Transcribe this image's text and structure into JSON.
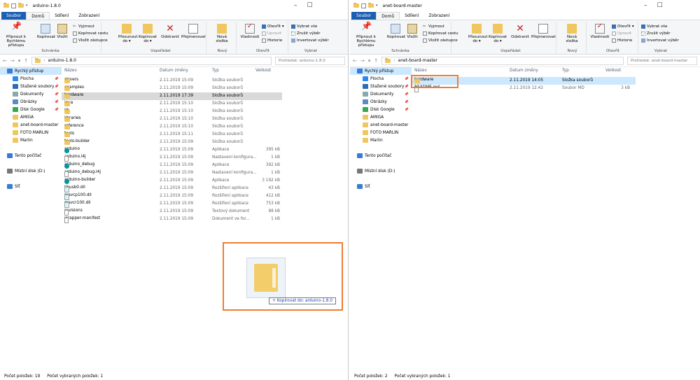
{
  "colors": {
    "accent": "#1a5fb4",
    "folder": "#f0c75e",
    "selected": "#cce8ff",
    "highlight": "#d9d9d9",
    "callout": "#ef7d33"
  },
  "left": {
    "title": "arduino-1.8.0",
    "tabs": [
      "Soubor",
      "Domů",
      "Sdílení",
      "Zobrazení"
    ],
    "ribbon": {
      "pin": "Připnout k Rychlému přístupu",
      "copy": "Kopírovat",
      "paste": "Vložit",
      "cut": "Vyjmout",
      "copy_path": "Kopírovat cestu",
      "paste_shortcut": "Vložit zástupce",
      "clipboard": "Schránka",
      "move_to": "Přesunout do ▾",
      "copy_to": "Kopírovat do ▾",
      "delete": "Odstranit",
      "rename": "Přejmenovat",
      "organize": "Uspořádat",
      "new_folder": "Nová složka",
      "new": "Nový",
      "properties": "Vlastnosti",
      "open": "Otevřít ▾",
      "edit": "Upravit",
      "history": "Historie",
      "open_group": "Otevřít",
      "select_all": "Vybrat vše",
      "select_none": "Zrušit výběr",
      "invert": "Invertovat výběr",
      "select_group": "Vybrat"
    },
    "path": "arduino-1.8.0",
    "search_placeholder": "Prohledat: arduino-1.8.0",
    "nav": [
      {
        "label": "Rychlý přístup",
        "icon": "star-icon",
        "pin": false
      },
      {
        "label": "Plocha",
        "icon": "desktop-icon",
        "pin": true
      },
      {
        "label": "Stažené soubory",
        "icon": "download-icon",
        "pin": true
      },
      {
        "label": "Dokumenty",
        "icon": "documents-icon",
        "pin": true
      },
      {
        "label": "Obrázky",
        "icon": "pictures-icon",
        "pin": true
      },
      {
        "label": "Disk Google",
        "icon": "google-drive-icon",
        "pin": true
      },
      {
        "label": "AMIGA",
        "icon": "folder-icon",
        "pin": false
      },
      {
        "label": "anet-board-master",
        "icon": "folder-icon",
        "pin": false
      },
      {
        "label": "FOTO MARLIN",
        "icon": "folder-icon",
        "pin": false
      },
      {
        "label": "Marlin",
        "icon": "folder-icon",
        "pin": false
      },
      {
        "label": "",
        "icon": "",
        "pin": false
      },
      {
        "label": "Tento počítač",
        "icon": "computer-icon",
        "pin": false
      },
      {
        "label": "",
        "icon": "",
        "pin": false
      },
      {
        "label": "Místní disk (D:)",
        "icon": "drive-icon",
        "pin": false
      },
      {
        "label": "",
        "icon": "",
        "pin": false
      },
      {
        "label": "Síť",
        "icon": "network-icon",
        "pin": false
      }
    ],
    "columns": [
      "Název",
      "Datum změny",
      "Typ",
      "Velikost"
    ],
    "files": [
      {
        "name": "drivers",
        "date": "2.11.2019 15:09",
        "type": "Složka souborů",
        "size": "",
        "icon": "folder"
      },
      {
        "name": "examples",
        "date": "2.11.2019 15:09",
        "type": "Složka souborů",
        "size": "",
        "icon": "folder"
      },
      {
        "name": "hardware",
        "date": "2.11.2019 17:39",
        "type": "Složka souborů",
        "size": "",
        "icon": "folder"
      },
      {
        "name": "java",
        "date": "2.11.2019 15:10",
        "type": "Složka souborů",
        "size": "",
        "icon": "folder"
      },
      {
        "name": "lib",
        "date": "2.11.2019 15:10",
        "type": "Složka souborů",
        "size": "",
        "icon": "folder"
      },
      {
        "name": "libraries",
        "date": "2.11.2019 15:10",
        "type": "Složka souborů",
        "size": "",
        "icon": "folder"
      },
      {
        "name": "reference",
        "date": "2.11.2019 15:10",
        "type": "Složka souborů",
        "size": "",
        "icon": "folder"
      },
      {
        "name": "tools",
        "date": "2.11.2019 15:11",
        "type": "Složka souborů",
        "size": "",
        "icon": "folder"
      },
      {
        "name": "tools-builder",
        "date": "2.11.2019 15:09",
        "type": "Složka souborů",
        "size": "",
        "icon": "folder"
      },
      {
        "name": "arduino",
        "date": "2.11.2019 15:09",
        "type": "Aplikace",
        "size": "395 kB",
        "icon": "app"
      },
      {
        "name": "arduino.l4j",
        "date": "2.11.2019 15:09",
        "type": "Nastavení konfigura...",
        "size": "1 kB",
        "icon": "file"
      },
      {
        "name": "arduino_debug",
        "date": "2.11.2019 15:09",
        "type": "Aplikace",
        "size": "392 kB",
        "icon": "app"
      },
      {
        "name": "arduino_debug.l4j",
        "date": "2.11.2019 15:09",
        "type": "Nastavení konfigura...",
        "size": "1 kB",
        "icon": "file"
      },
      {
        "name": "arduino-builder",
        "date": "2.11.2019 15:09",
        "type": "Aplikace",
        "size": "3 192 kB",
        "icon": "app"
      },
      {
        "name": "libusb0.dll",
        "date": "2.11.2019 15:09",
        "type": "Rozšíření aplikace",
        "size": "43 kB",
        "icon": "dll"
      },
      {
        "name": "msvcp100.dll",
        "date": "2.11.2019 15:09",
        "type": "Rozšíření aplikace",
        "size": "412 kB",
        "icon": "dll"
      },
      {
        "name": "msvcr100.dll",
        "date": "2.11.2019 15:09",
        "type": "Rozšíření aplikace",
        "size": "753 kB",
        "icon": "dll"
      },
      {
        "name": "revisions",
        "date": "2.11.2019 15:09",
        "type": "Textový dokument",
        "size": "88 kB",
        "icon": "file"
      },
      {
        "name": "wrapper-manifest",
        "date": "2.11.2019 15:09",
        "type": "Dokument ve for...",
        "size": "1 kB",
        "icon": "file"
      }
    ],
    "status_count": "Počet položek: 19",
    "status_selected": "Počet vybraných položek: 1",
    "drag_tooltip": "+ Kopírovat do: arduino-1.8.0"
  },
  "right": {
    "title": "anet-board-master",
    "tabs": [
      "Soubor",
      "Domů",
      "Sdílení",
      "Zobrazení"
    ],
    "path": "anet-board-master",
    "search_placeholder": "Prohledat: anet-board-master",
    "files": [
      {
        "name": "hardware",
        "date": "2.11.2019 14:05",
        "type": "Složka souborů",
        "size": "",
        "icon": "folder"
      },
      {
        "name": "README.md",
        "date": "2.11.2019 12:42",
        "type": "Soubor MD",
        "size": "3 kB",
        "icon": "file"
      }
    ],
    "status_count": "Počet položek: 2",
    "status_selected": "Počet vybraných položek: 1"
  }
}
